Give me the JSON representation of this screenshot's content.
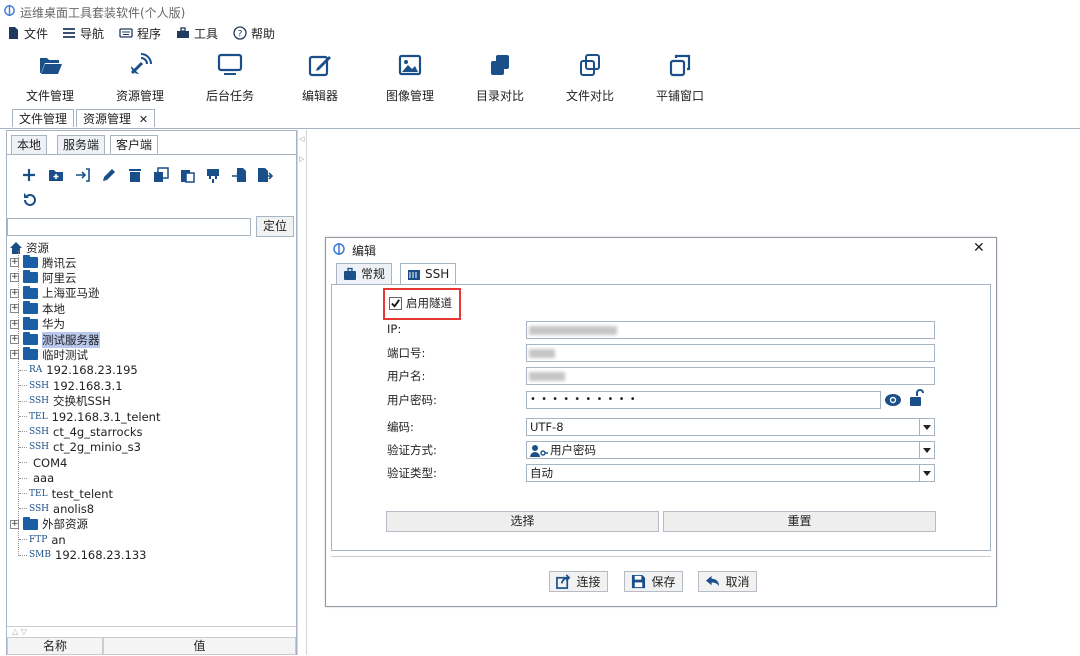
{
  "window": {
    "title": "运维桌面工具套装软件(个人版)"
  },
  "menu": [
    "文件",
    "导航",
    "程序",
    "工具",
    "帮助"
  ],
  "toolbar": [
    "文件管理",
    "资源管理",
    "后台任务",
    "编辑器",
    "图像管理",
    "目录对比",
    "文件对比",
    "平铺窗口"
  ],
  "main_tabs": [
    {
      "label": "文件管理"
    },
    {
      "label": "资源管理",
      "close": "✕"
    }
  ],
  "left_panel": {
    "tabs": [
      "本地",
      "服务端",
      "客户端"
    ],
    "search_value": "",
    "locate_label": "定位",
    "tree_root": "资源",
    "folders": [
      "腾讯云",
      "阿里云",
      "上海亚马逊",
      "本地",
      "华为",
      "测试服务器",
      "临时测试"
    ],
    "connections": [
      {
        "tag": "RA",
        "label": "192.168.23.195"
      },
      {
        "tag": "SSH",
        "label": "192.168.3.1"
      },
      {
        "tag": "SSH",
        "label": "交换机SSH"
      },
      {
        "tag": "TEL",
        "label": "192.168.3.1_telent"
      },
      {
        "tag": "SSH",
        "label": "ct_4g_starrocks"
      },
      {
        "tag": "SSH",
        "label": "ct_2g_minio_s3"
      },
      {
        "tag": "",
        "label": "COM4"
      },
      {
        "tag": "",
        "label": "aaa"
      },
      {
        "tag": "TEL",
        "label": "test_telent"
      },
      {
        "tag": "SSH",
        "label": "anolis8"
      }
    ],
    "external_folder": "外部资源",
    "external_connections": [
      {
        "tag": "FTP",
        "label": "an"
      },
      {
        "tag": "SMB",
        "label": "192.168.23.133"
      }
    ],
    "prop_headers": [
      "名称",
      "值"
    ]
  },
  "dialog": {
    "title": "编辑",
    "close": "✕",
    "tabs": [
      "常规",
      "SSH"
    ],
    "enable_tunnel": {
      "label": "启用隧道",
      "checked": true
    },
    "fields": {
      "ip_label": "IP:",
      "port_label": "端口号:",
      "user_label": "用户名:",
      "password_label": "用户密码:",
      "password_value": "• • • • • • • • • •",
      "encoding_label": "编码:",
      "encoding_value": "UTF-8",
      "auth_label": "验证方式:",
      "auth_value": "用户密码",
      "auth_type_label": "验证类型:",
      "auth_type_value": "自动"
    },
    "select_label": "选择",
    "reset_label": "重置",
    "connect_label": "连接",
    "save_label": "保存",
    "cancel_label": "取消"
  },
  "colors": {
    "accent": "#1a5fa6",
    "highlight": "#b9c8ec",
    "annotation_red": "#e53935"
  }
}
